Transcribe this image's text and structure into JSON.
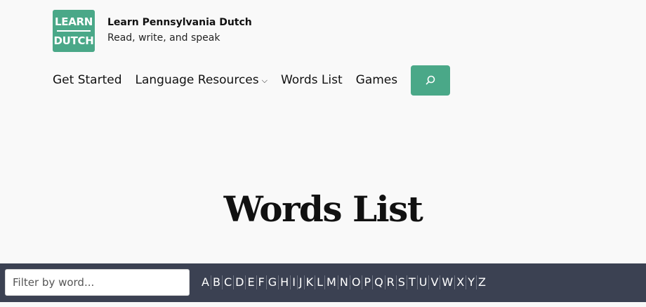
{
  "brand": {
    "logo_top": "LEARN",
    "logo_bottom": "DUTCH",
    "title": "Learn Pennsylvania Dutch",
    "tagline": "Read, write, and speak",
    "accent_color": "#4aa888"
  },
  "nav": {
    "items": [
      {
        "label": "Get Started"
      },
      {
        "label": "Language Resources",
        "has_dropdown": true
      },
      {
        "label": "Words List"
      },
      {
        "label": "Games"
      }
    ],
    "search_icon": "search-icon"
  },
  "main": {
    "title": "Words List"
  },
  "filter": {
    "placeholder": "Filter by word...",
    "value": "",
    "letters": [
      "A",
      "B",
      "C",
      "D",
      "E",
      "F",
      "G",
      "H",
      "I",
      "J",
      "K",
      "L",
      "M",
      "N",
      "O",
      "P",
      "Q",
      "R",
      "S",
      "T",
      "U",
      "V",
      "W",
      "X",
      "Y",
      "Z"
    ],
    "bar_color": "#3b4152"
  }
}
